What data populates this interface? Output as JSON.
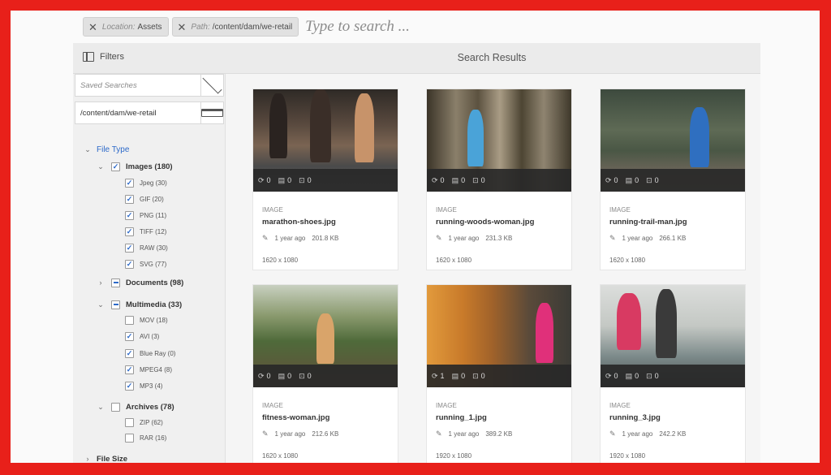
{
  "search": {
    "tags": [
      {
        "key": "Location:",
        "value": "Assets"
      },
      {
        "key": "Path:",
        "value": "/content/dam/we-retail"
      }
    ],
    "placeholder": "Type to search ..."
  },
  "header": {
    "filters_label": "Filters",
    "results_title": "Search Results"
  },
  "sidebar": {
    "saved_searches_placeholder": "Saved Searches",
    "path": "/content/dam/we-retail",
    "file_type_label": "File Type",
    "groups": [
      {
        "label": "Images (180)",
        "state": "checked",
        "expanded": true,
        "children": [
          {
            "label": "Jpeg (30)",
            "checked": true
          },
          {
            "label": "GIF (20)",
            "checked": true
          },
          {
            "label": "PNG (11)",
            "checked": true
          },
          {
            "label": "TIFF (12)",
            "checked": true
          },
          {
            "label": "RAW (30)",
            "checked": true
          },
          {
            "label": "SVG (77)",
            "checked": true
          }
        ]
      },
      {
        "label": "Documents (98)",
        "state": "partial",
        "expanded": false,
        "children": []
      },
      {
        "label": "Multimedia (33)",
        "state": "partial",
        "expanded": true,
        "children": [
          {
            "label": "MOV (18)",
            "checked": false
          },
          {
            "label": "AVI (3)",
            "checked": true
          },
          {
            "label": "Blue Ray (0)",
            "checked": true
          },
          {
            "label": "MPEG4 (8)",
            "checked": true
          },
          {
            "label": "MP3 (4)",
            "checked": true
          }
        ]
      },
      {
        "label": "Archives (78)",
        "state": "unchecked",
        "expanded": true,
        "children": [
          {
            "label": "ZIP (62)",
            "checked": false
          },
          {
            "label": "RAR (16)",
            "checked": false
          }
        ]
      }
    ],
    "file_size_label": "File Size"
  },
  "cards": [
    {
      "type": "IMAGE",
      "name": "marathon-shoes.jpg",
      "age": "1 year ago",
      "size": "201.8 KB",
      "dims": "1620 x 1080",
      "stats": [
        "0",
        "0",
        "0"
      ]
    },
    {
      "type": "IMAGE",
      "name": "running-woods-woman.jpg",
      "age": "1 year ago",
      "size": "231.3 KB",
      "dims": "1620 x 1080",
      "stats": [
        "0",
        "0",
        "0"
      ]
    },
    {
      "type": "IMAGE",
      "name": "running-trail-man.jpg",
      "age": "1 year ago",
      "size": "266.1 KB",
      "dims": "1620 x 1080",
      "stats": [
        "0",
        "0",
        "0"
      ]
    },
    {
      "type": "IMAGE",
      "name": "fitness-woman.jpg",
      "age": "1 year ago",
      "size": "212.6 KB",
      "dims": "1620 x 1080",
      "stats": [
        "0",
        "0",
        "0"
      ]
    },
    {
      "type": "IMAGE",
      "name": "running_1.jpg",
      "age": "1 year ago",
      "size": "389.2 KB",
      "dims": "1920 x 1080",
      "stats": [
        "1",
        "0",
        "0"
      ]
    },
    {
      "type": "IMAGE",
      "name": "running_3.jpg",
      "age": "1 year ago",
      "size": "242.2 KB",
      "dims": "1920 x 1080",
      "stats": [
        "0",
        "0",
        "0"
      ]
    }
  ],
  "colors": {
    "frame": "#e8201a",
    "accent": "#2d6ac9",
    "thumb_bar": "#282828"
  },
  "icons": [
    "close-icon",
    "panel-icon",
    "chevron-down-icon",
    "folder-browse-icon",
    "sync-icon",
    "comment-icon",
    "annotation-icon",
    "pencil-icon"
  ]
}
